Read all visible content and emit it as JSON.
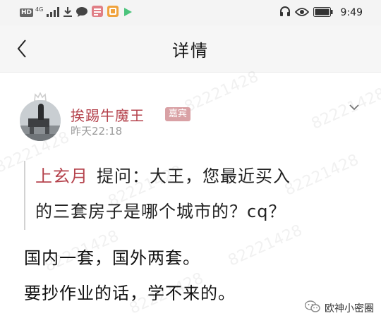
{
  "status_bar": {
    "hd_label": "HD",
    "network_label": "4G",
    "time": "9:49",
    "icons": [
      "signal-icon",
      "download-icon",
      "chat-icon",
      "app-icon",
      "app-icon",
      "play-icon",
      "headset-icon",
      "eye-icon",
      "battery-icon"
    ]
  },
  "header": {
    "title": "详情",
    "back_icon": "chevron-left-icon"
  },
  "post": {
    "author": {
      "name": "挨踢牛魔王",
      "badge": "嘉宾"
    },
    "timestamp": "昨天22:18",
    "quote": {
      "author": "上玄月",
      "line1": "提问：大王，您最近买入",
      "line2": "的三套房子是哪个城市的？cq？"
    },
    "body_lines": [
      "国内一套，国外两套。",
      "要抄作业的话，学不来的。"
    ]
  },
  "watermark": {
    "text": "82221428"
  },
  "brand": {
    "name": "欧神小密圈"
  },
  "colors": {
    "author_name": "#b5434d",
    "badge_bg": "#d9a1a5",
    "header_bg": "#f6f6f6",
    "status_bg": "#f4f4f4"
  }
}
